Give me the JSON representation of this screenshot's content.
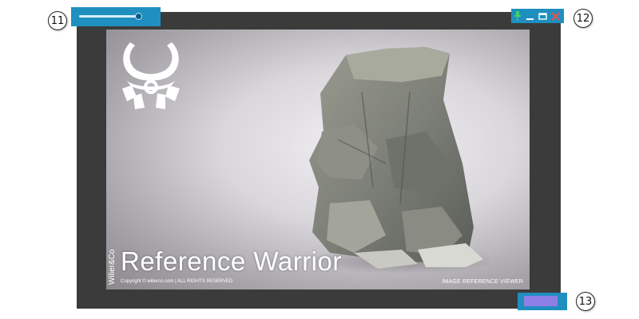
{
  "callouts": {
    "opacity": "11",
    "window_controls": "12",
    "resize": "13"
  },
  "opacity_slider": {
    "value_fraction": 0.95
  },
  "window_controls": {
    "pin_icon": "pin-icon",
    "minimize_icon": "minimize-icon",
    "maximize_icon": "maximize-icon",
    "close_icon": "close-icon"
  },
  "splash": {
    "title": "Reference Warrior",
    "vertical_brand": "Wilier&Co",
    "copyright": "Copyright © wilierco.com | ALL RIGHTS RESERVED",
    "subtitle": "IMAGE REFERENCE VIEWER"
  },
  "colors": {
    "highlight": "#1f8fbf",
    "window_bg": "#3b3b3b",
    "resize_grip": "#8e7fe6",
    "close": "#e25555",
    "pin": "#3fd16a"
  }
}
